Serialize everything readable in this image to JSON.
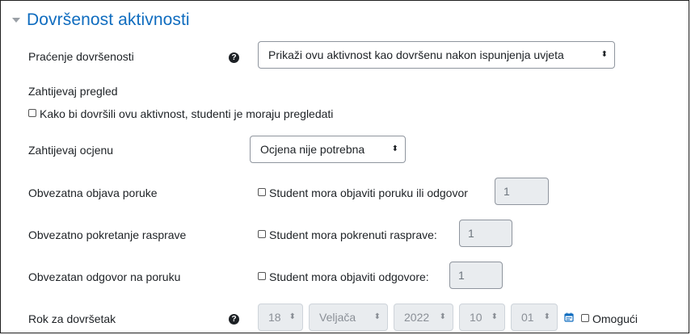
{
  "section": {
    "title": "Dovršenost aktivnosti"
  },
  "completion_tracking": {
    "label": "Praćenje dovršenosti",
    "value": "Prikaži ovu aktivnost kao dovršenu nakon ispunjenja uvjeta"
  },
  "require_view": {
    "label": "Zahtijevaj pregled",
    "checkbox_label": "Kako bi dovršili ovu aktivnost, studenti je moraju pregledati"
  },
  "require_grade": {
    "label": "Zahtijevaj ocjenu",
    "value": "Ocjena nije potrebna"
  },
  "require_posts": {
    "label": "Obvezatna objava poruke",
    "checkbox_label": "Student mora objaviti poruku ili odgovor",
    "value": "1"
  },
  "require_discussions": {
    "label": "Obvezatno pokretanje rasprave",
    "checkbox_label": "Student mora pokrenuti rasprave:",
    "value": "1"
  },
  "require_replies": {
    "label": "Obvezatan odgovor na poruku",
    "checkbox_label": "Student mora objaviti odgovore:",
    "value": "1"
  },
  "completion_date": {
    "label": "Rok za dovršetak",
    "day": "18",
    "month": "Veljača",
    "year": "2022",
    "hour": "10",
    "minute": "01",
    "enable_label": "Omogući"
  },
  "icons": {
    "help": "question-circle-icon",
    "calendar": "calendar-icon",
    "caret": "caret-down-icon"
  },
  "colors": {
    "title": "#0f6cbf",
    "help_icon": "#1d2125",
    "calendar_icon": "#0f6cbf"
  }
}
